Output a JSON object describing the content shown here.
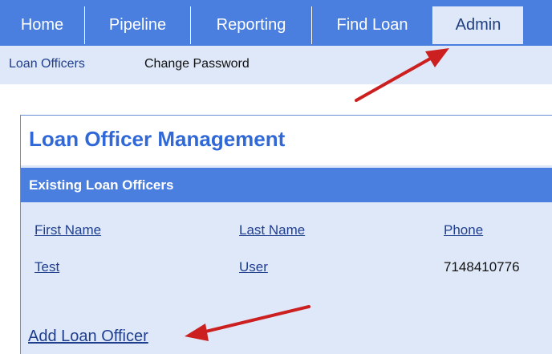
{
  "nav": {
    "tabs": [
      {
        "label": "Home"
      },
      {
        "label": "Pipeline"
      },
      {
        "label": "Reporting"
      },
      {
        "label": "Find Loan"
      },
      {
        "label": "Admin",
        "active": true
      }
    ]
  },
  "subnav": {
    "loan_officers": "Loan Officers",
    "change_password": "Change Password"
  },
  "panel": {
    "title": "Loan Officer Management",
    "section": "Existing Loan Officers",
    "columns": [
      "First Name",
      "Last Name",
      "Phone"
    ],
    "rows": [
      {
        "first": "Test",
        "last": "User",
        "phone": "7148410776"
      }
    ],
    "add_link": "Add Loan Officer"
  },
  "colors": {
    "nav_blue": "#4a7fe0",
    "light_bg": "#dfe8f8",
    "link_blue": "#1f3f8e",
    "title_blue": "#3068d8",
    "arrow_red": "#cc1f1f"
  }
}
